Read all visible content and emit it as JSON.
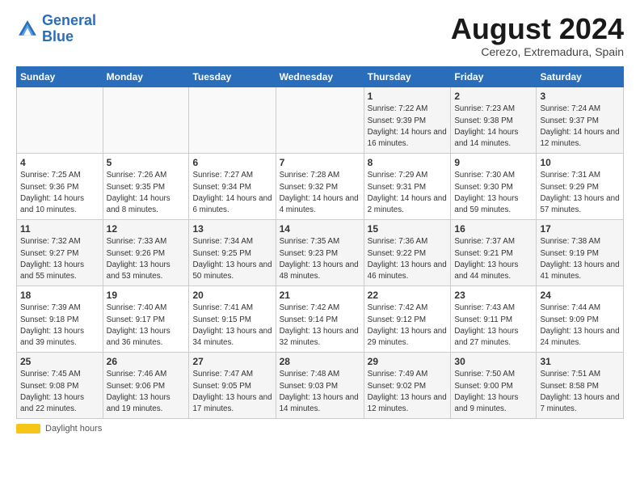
{
  "logo": {
    "line1": "General",
    "line2": "Blue"
  },
  "title": "August 2024",
  "location": "Cerezo, Extremadura, Spain",
  "days_of_week": [
    "Sunday",
    "Monday",
    "Tuesday",
    "Wednesday",
    "Thursday",
    "Friday",
    "Saturday"
  ],
  "footer": {
    "daylight_label": "Daylight hours"
  },
  "weeks": [
    [
      {
        "day": "",
        "info": ""
      },
      {
        "day": "",
        "info": ""
      },
      {
        "day": "",
        "info": ""
      },
      {
        "day": "",
        "info": ""
      },
      {
        "day": "1",
        "info": "Sunrise: 7:22 AM\nSunset: 9:39 PM\nDaylight: 14 hours\nand 16 minutes."
      },
      {
        "day": "2",
        "info": "Sunrise: 7:23 AM\nSunset: 9:38 PM\nDaylight: 14 hours\nand 14 minutes."
      },
      {
        "day": "3",
        "info": "Sunrise: 7:24 AM\nSunset: 9:37 PM\nDaylight: 14 hours\nand 12 minutes."
      }
    ],
    [
      {
        "day": "4",
        "info": "Sunrise: 7:25 AM\nSunset: 9:36 PM\nDaylight: 14 hours\nand 10 minutes."
      },
      {
        "day": "5",
        "info": "Sunrise: 7:26 AM\nSunset: 9:35 PM\nDaylight: 14 hours\nand 8 minutes."
      },
      {
        "day": "6",
        "info": "Sunrise: 7:27 AM\nSunset: 9:34 PM\nDaylight: 14 hours\nand 6 minutes."
      },
      {
        "day": "7",
        "info": "Sunrise: 7:28 AM\nSunset: 9:32 PM\nDaylight: 14 hours\nand 4 minutes."
      },
      {
        "day": "8",
        "info": "Sunrise: 7:29 AM\nSunset: 9:31 PM\nDaylight: 14 hours\nand 2 minutes."
      },
      {
        "day": "9",
        "info": "Sunrise: 7:30 AM\nSunset: 9:30 PM\nDaylight: 13 hours\nand 59 minutes."
      },
      {
        "day": "10",
        "info": "Sunrise: 7:31 AM\nSunset: 9:29 PM\nDaylight: 13 hours\nand 57 minutes."
      }
    ],
    [
      {
        "day": "11",
        "info": "Sunrise: 7:32 AM\nSunset: 9:27 PM\nDaylight: 13 hours\nand 55 minutes."
      },
      {
        "day": "12",
        "info": "Sunrise: 7:33 AM\nSunset: 9:26 PM\nDaylight: 13 hours\nand 53 minutes."
      },
      {
        "day": "13",
        "info": "Sunrise: 7:34 AM\nSunset: 9:25 PM\nDaylight: 13 hours\nand 50 minutes."
      },
      {
        "day": "14",
        "info": "Sunrise: 7:35 AM\nSunset: 9:23 PM\nDaylight: 13 hours\nand 48 minutes."
      },
      {
        "day": "15",
        "info": "Sunrise: 7:36 AM\nSunset: 9:22 PM\nDaylight: 13 hours\nand 46 minutes."
      },
      {
        "day": "16",
        "info": "Sunrise: 7:37 AM\nSunset: 9:21 PM\nDaylight: 13 hours\nand 44 minutes."
      },
      {
        "day": "17",
        "info": "Sunrise: 7:38 AM\nSunset: 9:19 PM\nDaylight: 13 hours\nand 41 minutes."
      }
    ],
    [
      {
        "day": "18",
        "info": "Sunrise: 7:39 AM\nSunset: 9:18 PM\nDaylight: 13 hours\nand 39 minutes."
      },
      {
        "day": "19",
        "info": "Sunrise: 7:40 AM\nSunset: 9:17 PM\nDaylight: 13 hours\nand 36 minutes."
      },
      {
        "day": "20",
        "info": "Sunrise: 7:41 AM\nSunset: 9:15 PM\nDaylight: 13 hours\nand 34 minutes."
      },
      {
        "day": "21",
        "info": "Sunrise: 7:42 AM\nSunset: 9:14 PM\nDaylight: 13 hours\nand 32 minutes."
      },
      {
        "day": "22",
        "info": "Sunrise: 7:42 AM\nSunset: 9:12 PM\nDaylight: 13 hours\nand 29 minutes."
      },
      {
        "day": "23",
        "info": "Sunrise: 7:43 AM\nSunset: 9:11 PM\nDaylight: 13 hours\nand 27 minutes."
      },
      {
        "day": "24",
        "info": "Sunrise: 7:44 AM\nSunset: 9:09 PM\nDaylight: 13 hours\nand 24 minutes."
      }
    ],
    [
      {
        "day": "25",
        "info": "Sunrise: 7:45 AM\nSunset: 9:08 PM\nDaylight: 13 hours\nand 22 minutes."
      },
      {
        "day": "26",
        "info": "Sunrise: 7:46 AM\nSunset: 9:06 PM\nDaylight: 13 hours\nand 19 minutes."
      },
      {
        "day": "27",
        "info": "Sunrise: 7:47 AM\nSunset: 9:05 PM\nDaylight: 13 hours\nand 17 minutes."
      },
      {
        "day": "28",
        "info": "Sunrise: 7:48 AM\nSunset: 9:03 PM\nDaylight: 13 hours\nand 14 minutes."
      },
      {
        "day": "29",
        "info": "Sunrise: 7:49 AM\nSunset: 9:02 PM\nDaylight: 13 hours\nand 12 minutes."
      },
      {
        "day": "30",
        "info": "Sunrise: 7:50 AM\nSunset: 9:00 PM\nDaylight: 13 hours\nand 9 minutes."
      },
      {
        "day": "31",
        "info": "Sunrise: 7:51 AM\nSunset: 8:58 PM\nDaylight: 13 hours\nand 7 minutes."
      }
    ]
  ]
}
